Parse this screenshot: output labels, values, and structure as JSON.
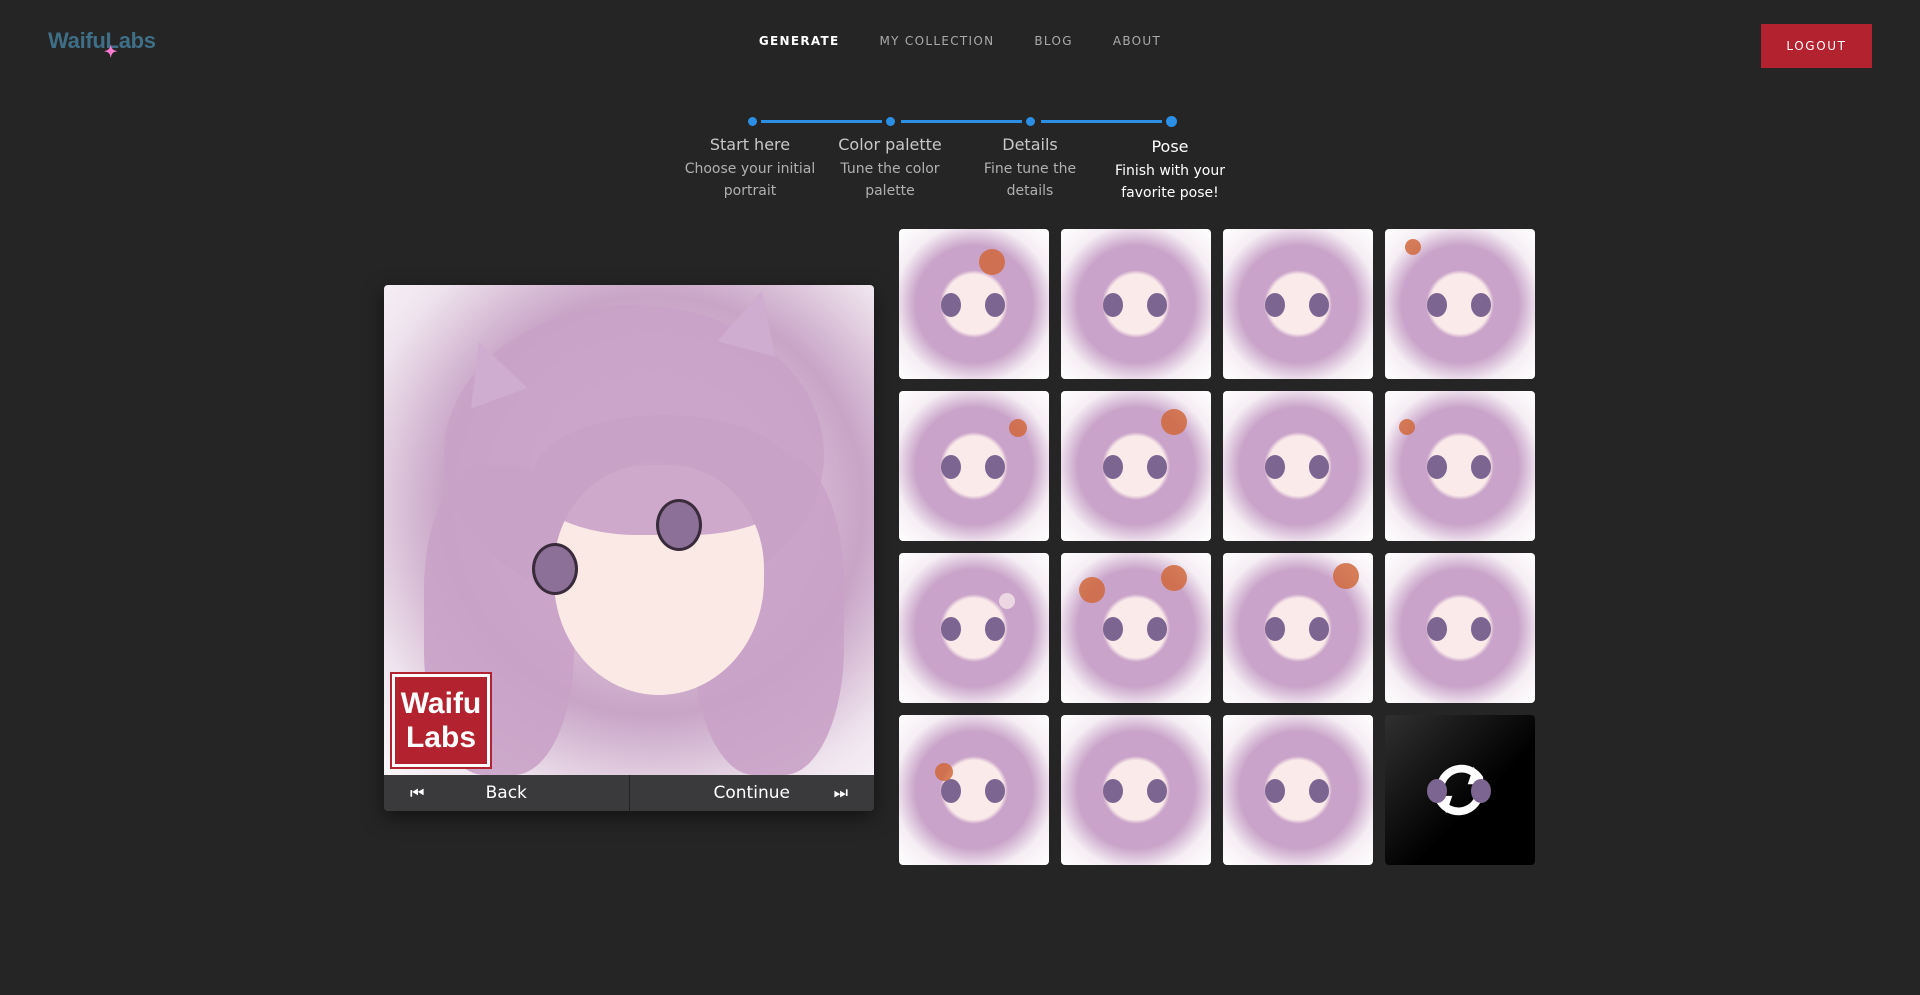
{
  "header": {
    "logo": "WaifuLabs",
    "nav": [
      "GENERATE",
      "MY COLLECTION",
      "BLOG",
      "ABOUT"
    ],
    "logout": "LOGOUT"
  },
  "stepper": {
    "steps": [
      {
        "title": "Start here",
        "sub1": "Choose your initial",
        "sub2": "portrait"
      },
      {
        "title": "Color palette",
        "sub1": "Tune the color",
        "sub2": "palette"
      },
      {
        "title": "Details",
        "sub1": "Fine tune the",
        "sub2": "details"
      },
      {
        "title": "Pose",
        "sub1": "Finish with your",
        "sub2": "favorite pose!"
      }
    ],
    "current_step": 4
  },
  "preview": {
    "watermark_line1": "Waifu",
    "watermark_line2": "Labs",
    "back": "Back",
    "continue": "Continue"
  },
  "colors": {
    "background": "#252526",
    "accent": "#2b8fe5",
    "logout": "#b3222f"
  },
  "grid": {
    "thumb_count": 15,
    "refresh_icon": "refresh-icon"
  }
}
